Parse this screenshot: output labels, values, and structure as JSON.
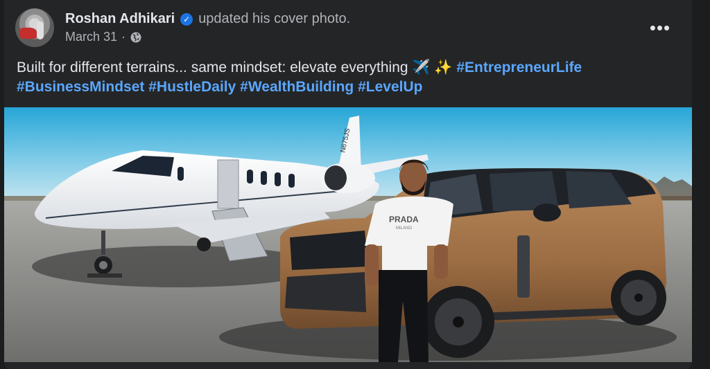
{
  "post": {
    "author": "Roshan Adhikari",
    "verified": true,
    "action_text": "updated his cover photo.",
    "date": "March 31",
    "separator": "·",
    "audience_icon": "globe-icon",
    "more_icon": "more-horizontal-icon",
    "caption": {
      "text": "Built for different terrains... same mindset: elevate everything ✈️ ✨",
      "hashtags": [
        "#EntrepreneurLife",
        "#BusinessMindset",
        "#HustleDaily",
        "#WealthBuilding",
        "#LevelUp"
      ]
    },
    "photo": {
      "plane_tail": "N675JS",
      "shirt_text": "PRADA",
      "shirt_subtext": "MILANO"
    }
  },
  "colors": {
    "background": "#1c1d1f",
    "card": "#242526",
    "text_primary": "#e4e6eb",
    "text_secondary": "#b0b3b8",
    "hashtag": "#5aa7ff",
    "verified_badge": "#1b74e4"
  }
}
